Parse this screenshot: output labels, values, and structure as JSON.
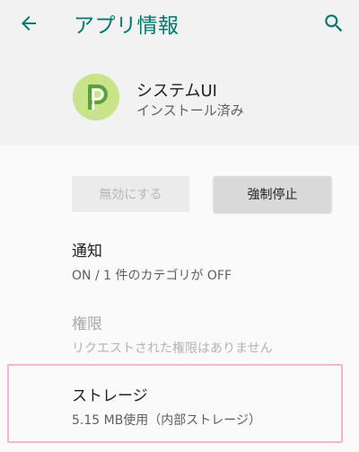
{
  "toolbar": {
    "title": "アプリ情報",
    "back_icon": "arrow-back-icon",
    "search_icon": "search-icon",
    "accent": "#00796b"
  },
  "app": {
    "name": "システムUI",
    "status": "インストール済み",
    "icon": "android-p-icon",
    "icon_color": "#c9e38a"
  },
  "buttons": {
    "disable": "無効にする",
    "force_stop": "強制停止"
  },
  "preferences": [
    {
      "title": "通知",
      "summary": "ON / 1 件のカテゴリが OFF",
      "enabled": true
    },
    {
      "title": "権限",
      "summary": "リクエストされた権限はありません",
      "enabled": false
    },
    {
      "title": "ストレージ",
      "summary": "5.15 MB使用（内部ストレージ）",
      "enabled": true,
      "highlighted": true
    }
  ]
}
